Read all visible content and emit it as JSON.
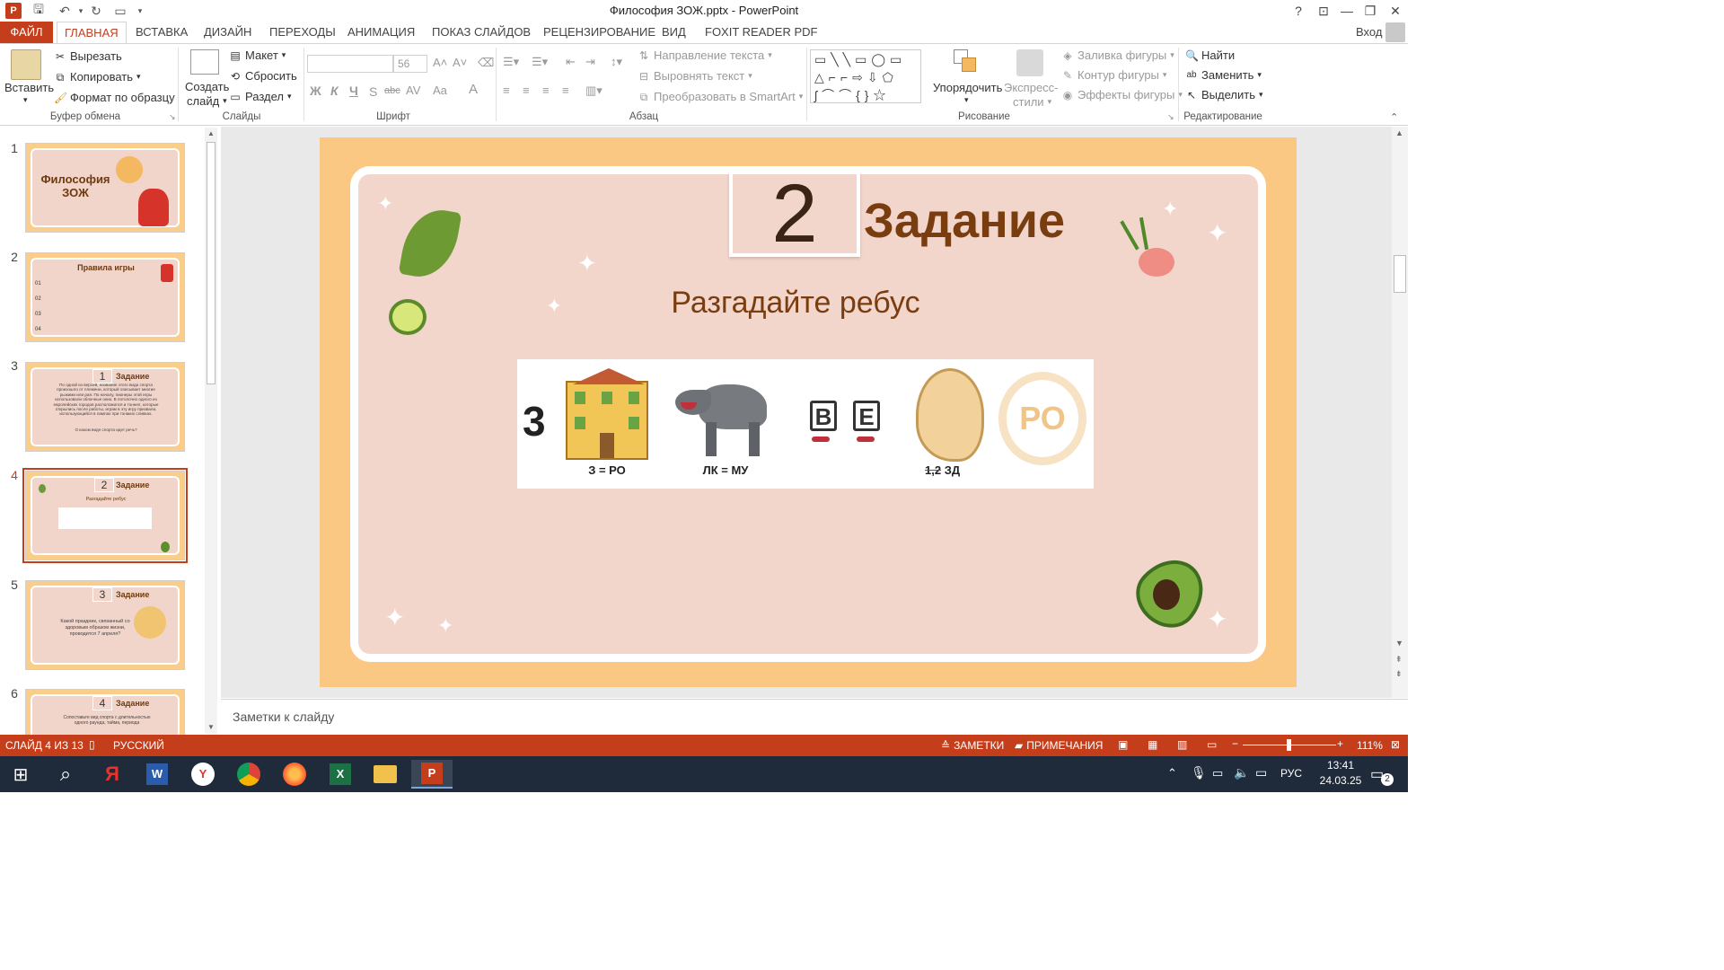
{
  "window": {
    "title": "Философия ЗОЖ.pptx - PowerPoint",
    "help": "?",
    "login": "Вход"
  },
  "tabs": [
    "ФАЙЛ",
    "ГЛАВНАЯ",
    "ВСТАВКА",
    "ДИЗАЙН",
    "ПЕРЕХОДЫ",
    "АНИМАЦИЯ",
    "ПОКАЗ СЛАЙДОВ",
    "РЕЦЕНЗИРОВАНИЕ",
    "ВИД",
    "FOXIT READER PDF"
  ],
  "ribbon": {
    "clipboard": {
      "paste": "Вставить",
      "cut": "Вырезать",
      "copy": "Копировать",
      "format": "Формат по образцу",
      "label": "Буфер обмена"
    },
    "slides": {
      "new_slide_1": "Создать",
      "new_slide_2": "слайд",
      "layout": "Макет",
      "reset": "Сбросить",
      "section": "Раздел",
      "label": "Слайды"
    },
    "font": {
      "size": "56",
      "bold": "Ж",
      "italic": "К",
      "underline": "Ч",
      "strike": "abc",
      "spacing": "AV",
      "case": "Aa",
      "color": "A",
      "label": "Шрифт"
    },
    "paragraph": {
      "text_dir": "Направление текста",
      "align_text": "Выровнять текст",
      "smartart": "Преобразовать в SmartArt",
      "label": "Абзац"
    },
    "drawing": {
      "arrange": "Упорядочить",
      "styles_1": "Экспресс-",
      "styles_2": "стили",
      "fill": "Заливка фигуры",
      "outline": "Контур фигуры",
      "effects": "Эффекты фигуры",
      "label": "Рисование"
    },
    "editing": {
      "find": "Найти",
      "replace": "Заменить",
      "select": "Выделить",
      "label": "Редактирование"
    }
  },
  "thumbnails": [
    {
      "num": "1",
      "title": "Философия ЗОЖ"
    },
    {
      "num": "2",
      "title": "Правила игры",
      "rows": [
        "01",
        "02",
        "03",
        "04"
      ]
    },
    {
      "num": "3",
      "badge": "1",
      "title": "Задание",
      "text": "По одной из версий, название этого вида спорта произошло от племени, который описывает многие рыжими или рая. По началу, пионеры этой игры использовали облачные окна. В потолочно одного из европейских городов расположился и тоннел, которые открылись после работы, играм в эту игру призвали, использующийся в лампах при тонаких сливках.",
      "question": "О каком виде спорта идет речь?"
    },
    {
      "num": "4",
      "badge": "2",
      "title": "Задание",
      "sub": "Разгадайте ребус"
    },
    {
      "num": "5",
      "badge": "3",
      "title": "Задание",
      "text": "Какой праздник, связанный со здоровым образом жизни, проводится 7 апреля?"
    },
    {
      "num": "6",
      "badge": "4",
      "title": "Задание",
      "text": "Сопоставьте вид спорта с длительностью одного раунда, тайма, периода"
    }
  ],
  "slide": {
    "number": "2",
    "title": "Задание",
    "subtitle": "Разгадайте ребус",
    "rebus": {
      "lead": "3",
      "house_caption": "З = РО",
      "wolf_caption": "ЛК = МУ",
      "letters": [
        "В",
        "Е"
      ],
      "ear_strike": "1,2",
      "ear_caption": "ЗД",
      "circle_text": "РО"
    }
  },
  "notes_placeholder": "Заметки к слайду",
  "status": {
    "slide": "СЛАЙД 4 ИЗ 13",
    "lang": "РУССКИЙ",
    "notes": "ЗАМЕТКИ",
    "comments": "ПРИМЕЧАНИЯ",
    "zoom": "111%"
  },
  "taskbar": {
    "lang": "РУС",
    "time": "13:41",
    "date": "24.03.25",
    "notif": "2"
  }
}
